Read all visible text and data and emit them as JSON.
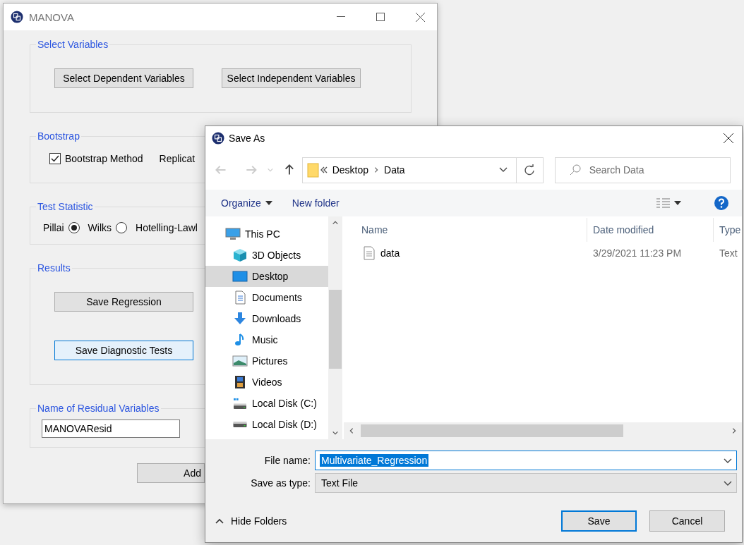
{
  "manova": {
    "title": "MANOVA",
    "select_variables": {
      "title": "Select Variables",
      "buttons": [
        "Select Dependent Variables",
        "Select Independent Variables"
      ]
    },
    "bootstrap": {
      "title": "Bootstrap",
      "checkbox": {
        "label": "Bootstrap Method",
        "checked": true
      },
      "cut_label": "Replicat"
    },
    "test_statistic": {
      "title": "Test Statistic",
      "options": [
        {
          "label": "Pillai",
          "selected": true
        },
        {
          "label": "Wilks",
          "selected": false
        }
      ],
      "cut_label": "Hotelling-Lawl"
    },
    "results": {
      "title": "Results",
      "buttons": [
        {
          "label": "Save Regression",
          "focused": false
        },
        {
          "label": "Save Diagnostic Tests",
          "focused": true
        }
      ]
    },
    "residual": {
      "title": "Name of Residual Variables",
      "value": "MANOVAResid"
    },
    "cut_button": "Add"
  },
  "save_as": {
    "title": "Save As",
    "breadcrumb": [
      "Desktop",
      "Data"
    ],
    "search": {
      "placeholder": "Search Data"
    },
    "toolbar": [
      "Organize",
      "New folder"
    ],
    "nav": [
      {
        "label": "This PC",
        "kind": "pc",
        "selected": false,
        "children": [
          {
            "label": "3D Objects",
            "kind": "objects",
            "selected": false
          },
          {
            "label": "Desktop",
            "kind": "desktop",
            "selected": true
          },
          {
            "label": "Documents",
            "kind": "documents",
            "selected": false
          },
          {
            "label": "Downloads",
            "kind": "downloads",
            "selected": false
          },
          {
            "label": "Music",
            "kind": "music",
            "selected": false
          },
          {
            "label": "Pictures",
            "kind": "pictures",
            "selected": false
          },
          {
            "label": "Videos",
            "kind": "videos",
            "selected": false
          },
          {
            "label": "Local Disk (C:)",
            "kind": "system_disk",
            "selected": false
          },
          {
            "label": "Local Disk (D:)",
            "kind": "disk",
            "selected": false
          }
        ]
      }
    ],
    "columns": [
      "Name",
      "Date modified",
      "Type"
    ],
    "files": [
      {
        "name": "data",
        "date": "3/29/2021 11:23 PM",
        "type": "Text"
      }
    ],
    "file_name_label": "File name:",
    "file_name": "Multivariate_Regression",
    "type_label": "Save as type:",
    "file_type": "Text File",
    "hide_folders": "Hide Folders",
    "buttons": [
      {
        "label": "Save",
        "default": true
      },
      {
        "label": "Cancel",
        "default": false
      }
    ]
  }
}
